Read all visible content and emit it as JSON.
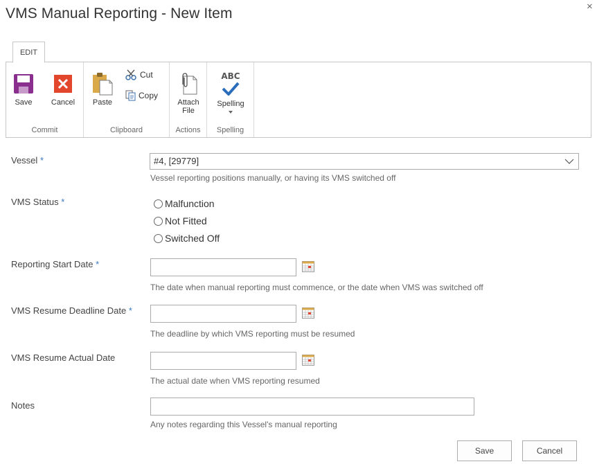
{
  "dialog": {
    "title": "VMS Manual Reporting - New Item",
    "close_glyph": "×"
  },
  "ribbon": {
    "tab": "EDIT",
    "groups": {
      "commit": {
        "label": "Commit",
        "save": "Save",
        "cancel": "Cancel"
      },
      "clipboard": {
        "label": "Clipboard",
        "paste": "Paste",
        "cut": "Cut",
        "copy": "Copy"
      },
      "actions": {
        "label": "Actions",
        "attach_line1": "Attach",
        "attach_line2": "File"
      },
      "spelling": {
        "label": "Spelling",
        "spelling": "Spelling",
        "abc": "ABC"
      }
    }
  },
  "form": {
    "vessel": {
      "label": "Vessel",
      "required": "*",
      "value": "#4, [29779]",
      "hint": "Vessel reporting positions manually, or having its VMS switched off"
    },
    "vms_status": {
      "label": "VMS Status",
      "required": "*",
      "options": [
        "Malfunction",
        "Not Fitted",
        "Switched Off"
      ]
    },
    "reporting_start_date": {
      "label": "Reporting Start Date",
      "required": "*",
      "value": "",
      "hint": "The date when manual reporting must commence, or the date when VMS was switched off"
    },
    "vms_resume_deadline_date": {
      "label": "VMS Resume Deadline Date",
      "required": "*",
      "value": "",
      "hint": "The deadline by which VMS reporting must be resumed"
    },
    "vms_resume_actual_date": {
      "label": "VMS Resume Actual Date",
      "value": "",
      "hint": "The actual date when VMS reporting resumed"
    },
    "notes": {
      "label": "Notes",
      "value": "",
      "hint": "Any notes regarding this Vessel's manual reporting"
    }
  },
  "footer": {
    "save": "Save",
    "cancel": "Cancel"
  },
  "colors": {
    "accent": "#3a7abf",
    "save_icon": "#8b2f8f",
    "cancel_icon": "#e2462c",
    "spell_check": "#2a6ebb"
  }
}
